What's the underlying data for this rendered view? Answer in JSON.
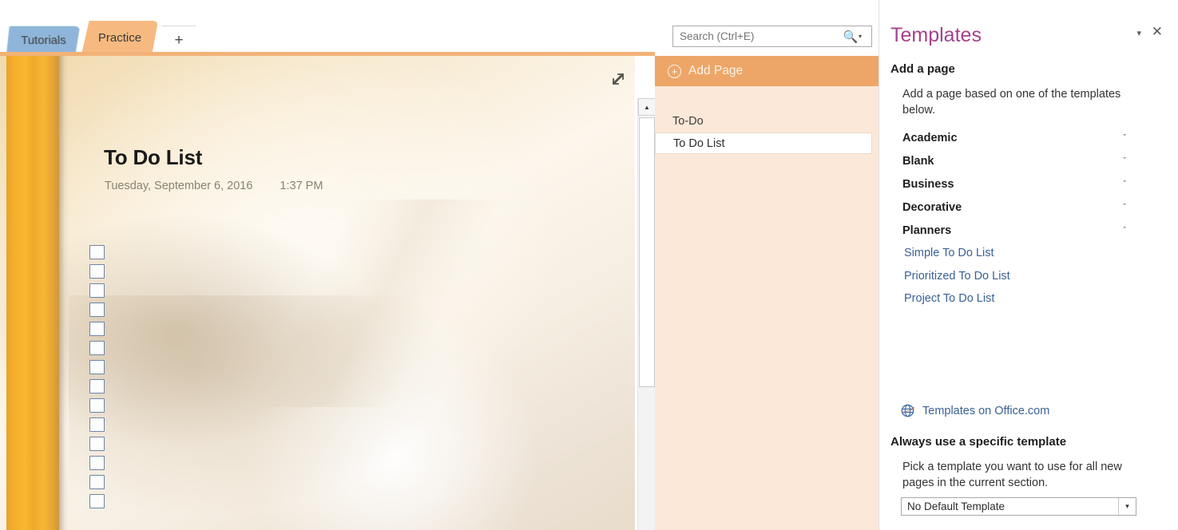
{
  "tabs": [
    {
      "label": "Tutorials",
      "color": "#8FB6DA",
      "active": false
    },
    {
      "label": "Practice",
      "color": "#F6BA80",
      "active": true
    },
    {
      "label": "+",
      "color": "#FFFFFF",
      "active": false
    }
  ],
  "search": {
    "placeholder": "Search (Ctrl+E)",
    "value": "",
    "icon": "search-icon",
    "caret": "▾"
  },
  "pagelist": {
    "add_page_label": "Add Page",
    "add_page_icon": "+",
    "group_label": "To-Do",
    "page_label": "To Do List",
    "bg_color": "#FCE8D8",
    "add_page_color": "#EDA667"
  },
  "page": {
    "title": "To Do List",
    "date": "Tuesday, September 6, 2016",
    "time": "1:37 PM",
    "checkbox_count": 14,
    "expand_icon": "expand-arrow-icon"
  },
  "scrollbar": {
    "up_arrow": "▲"
  },
  "pane": {
    "title": "Templates",
    "title_color": "#A4428C",
    "caret": "▾",
    "close": "✕",
    "add_a_page_heading": "Add a page",
    "add_a_page_desc": "Add a page based on one of the templates below.",
    "categories": [
      {
        "label": "Academic",
        "expanded": false,
        "chevron": "ˇ"
      },
      {
        "label": "Blank",
        "expanded": false,
        "chevron": "ˇ"
      },
      {
        "label": "Business",
        "expanded": false,
        "chevron": "ˇ"
      },
      {
        "label": "Decorative",
        "expanded": false,
        "chevron": "ˇ"
      },
      {
        "label": "Planners",
        "expanded": true,
        "chevron": "ˆ"
      }
    ],
    "templates": [
      "Simple To Do List",
      "Prioritized To Do List",
      "Project To Do List"
    ],
    "office_link": "Templates on Office.com",
    "office_icon": "globe-icon",
    "always_use_heading": "Always use a specific template",
    "always_use_desc": "Pick a template you want to use for all new pages in the current section.",
    "default_template": "No Default Template",
    "default_template_arrow": "▾"
  }
}
